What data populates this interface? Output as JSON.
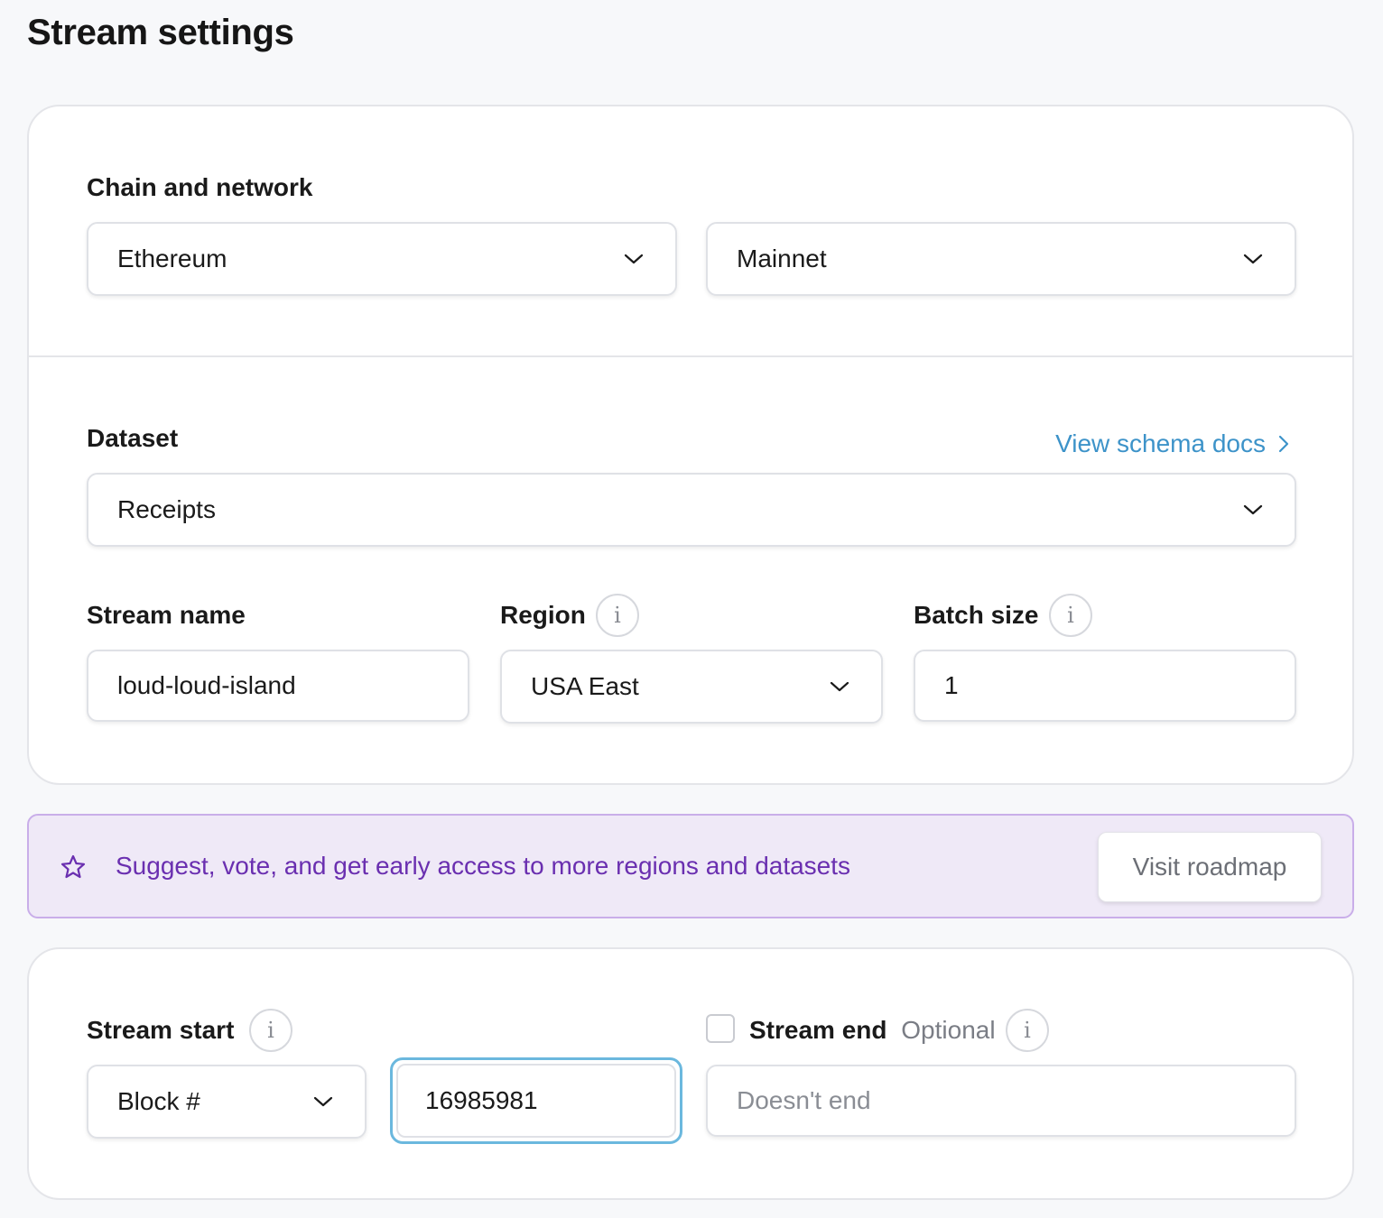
{
  "page_title": "Stream settings",
  "chain_network": {
    "label": "Chain and network",
    "chain_value": "Ethereum",
    "network_value": "Mainnet"
  },
  "dataset": {
    "label": "Dataset",
    "value": "Receipts",
    "docs_link": "View schema docs"
  },
  "stream_name": {
    "label": "Stream name",
    "value": "loud-loud-island"
  },
  "region": {
    "label": "Region",
    "value": "USA East",
    "info_glyph": "i"
  },
  "batch_size": {
    "label": "Batch size",
    "value": "1",
    "info_glyph": "i"
  },
  "banner": {
    "text": "Suggest, vote, and get early access to more regions and datasets",
    "button_label": "Visit roadmap",
    "accent_color": "#6a2fb0"
  },
  "stream_start": {
    "label": "Stream start",
    "type_value": "Block #",
    "block_value": "16985981",
    "info_glyph": "i"
  },
  "stream_end": {
    "label": "Stream end",
    "optional_label": "Optional",
    "placeholder": "Doesn't end",
    "checked": false,
    "info_glyph": "i"
  },
  "colors": {
    "link": "#3d93c9",
    "focus_ring": "#6bb8de",
    "banner_bg": "#efe9f7",
    "page_bg": "#f7f8fa"
  }
}
